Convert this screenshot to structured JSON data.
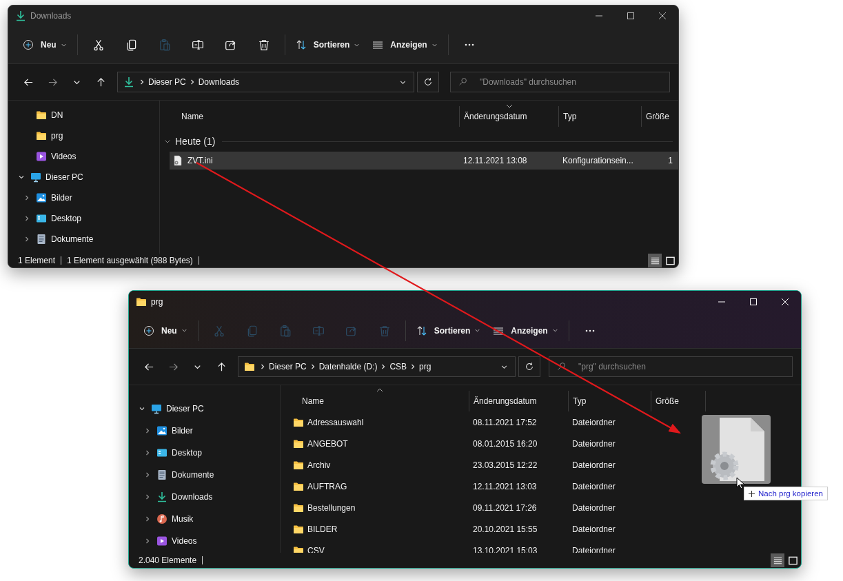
{
  "windows": [
    {
      "title": "Downloads",
      "kind": "downloads",
      "active": false,
      "toolbar": {
        "new_label": "Neu",
        "actions": [
          {
            "kind": "cut",
            "disabled": false
          },
          {
            "kind": "copy",
            "disabled": false
          },
          {
            "kind": "paste",
            "disabled": true
          },
          {
            "kind": "rename",
            "disabled": false
          },
          {
            "kind": "share",
            "disabled": false
          },
          {
            "kind": "delete",
            "disabled": false
          }
        ],
        "sort_label": "Sortieren",
        "view_label": "Anzeigen"
      },
      "nav": {
        "back_disabled": false,
        "forward_disabled": true
      },
      "address": {
        "crumbs": [
          "Dieser PC",
          "Downloads"
        ]
      },
      "search": {
        "placeholder": "\"Downloads\" durchsuchen"
      },
      "sidebar": {
        "items": [
          {
            "label": "DN",
            "kind": "folder"
          },
          {
            "label": "prg",
            "kind": "folder"
          },
          {
            "label": "Videos",
            "kind": "videos"
          },
          {
            "label": "Dieser PC",
            "kind": "pc",
            "expanded": true,
            "children": [
              {
                "label": "Bilder",
                "kind": "pictures",
                "expanded": false
              },
              {
                "label": "Desktop",
                "kind": "desktop",
                "expanded": false
              },
              {
                "label": "Dokumente",
                "kind": "documents",
                "expanded": false
              }
            ]
          }
        ]
      },
      "columns": [
        {
          "label": "Name",
          "sorted": false
        },
        {
          "label": "Änderungsdatum",
          "sorted": true
        },
        {
          "label": "Typ",
          "sorted": false
        },
        {
          "label": "Größe",
          "sorted": false
        }
      ],
      "sort_descending": true,
      "group": {
        "label": "Heute (1)",
        "expanded": true
      },
      "rows": [
        {
          "name": "ZVT.ini",
          "kind": "file",
          "date": "12.11.2021 13:08",
          "type": "Konfigurationsein...",
          "size": "1",
          "selected": true
        }
      ],
      "status": [
        "1 Element",
        "1 Element ausgewählt (988 Bytes)"
      ],
      "views": [
        {
          "kind": "details",
          "selected": true
        },
        {
          "kind": "tiles",
          "selected": false
        }
      ]
    },
    {
      "title": "prg",
      "kind": "folder",
      "active": true,
      "toolbar": {
        "new_label": "Neu",
        "actions": [
          {
            "kind": "cut",
            "disabled": true
          },
          {
            "kind": "copy",
            "disabled": true
          },
          {
            "kind": "paste",
            "disabled": true
          },
          {
            "kind": "rename",
            "disabled": true
          },
          {
            "kind": "share",
            "disabled": true
          },
          {
            "kind": "delete",
            "disabled": true
          }
        ],
        "sort_label": "Sortieren",
        "view_label": "Anzeigen"
      },
      "nav": {
        "back_disabled": false,
        "forward_disabled": true
      },
      "address": {
        "crumbs": [
          "Dieser PC",
          "Datenhalde (D:)",
          "CSB",
          "prg"
        ]
      },
      "search": {
        "placeholder": "\"prg\" durchsuchen"
      },
      "sidebar": {
        "items": [
          {
            "label": "Dieser PC",
            "kind": "pc",
            "expanded": true,
            "children": [
              {
                "label": "Bilder",
                "kind": "pictures",
                "expanded": false
              },
              {
                "label": "Desktop",
                "kind": "desktop",
                "expanded": false
              },
              {
                "label": "Dokumente",
                "kind": "documents",
                "expanded": false
              },
              {
                "label": "Downloads",
                "kind": "downloads",
                "expanded": false
              },
              {
                "label": "Musik",
                "kind": "music",
                "expanded": false
              },
              {
                "label": "Videos",
                "kind": "videos",
                "expanded": false
              }
            ]
          }
        ]
      },
      "columns": [
        {
          "label": "Name",
          "sorted": true
        },
        {
          "label": "Änderungsdatum",
          "sorted": false
        },
        {
          "label": "Typ",
          "sorted": false
        },
        {
          "label": "Größe",
          "sorted": false
        }
      ],
      "sort_descending": false,
      "rows": [
        {
          "name": "Adressauswahl",
          "kind": "folder",
          "date": "08.11.2021 17:52",
          "type": "Dateiordner",
          "selected": false
        },
        {
          "name": "ANGEBOT",
          "kind": "folder",
          "date": "08.01.2015 16:20",
          "type": "Dateiordner",
          "selected": false
        },
        {
          "name": "Archiv",
          "kind": "folder",
          "date": "23.03.2015 12:22",
          "type": "Dateiordner",
          "selected": false
        },
        {
          "name": "AUFTRAG",
          "kind": "folder",
          "date": "12.11.2021 13:03",
          "type": "Dateiordner",
          "selected": false
        },
        {
          "name": "Bestellungen",
          "kind": "folder",
          "date": "09.11.2021 17:26",
          "type": "Dateiordner",
          "selected": false
        },
        {
          "name": "BILDER",
          "kind": "folder",
          "date": "20.10.2021 15:55",
          "type": "Dateiordner",
          "selected": false
        },
        {
          "name": "CSV",
          "kind": "folder",
          "date": "13.10.2021 15:03",
          "type": "Dateiordner",
          "selected": false
        }
      ],
      "status": [
        "2.040 Elemente"
      ],
      "views": [
        {
          "kind": "details",
          "selected": true
        },
        {
          "kind": "tiles",
          "selected": false
        }
      ]
    }
  ],
  "drag": {
    "tooltip": "Nach prg kopieren"
  }
}
